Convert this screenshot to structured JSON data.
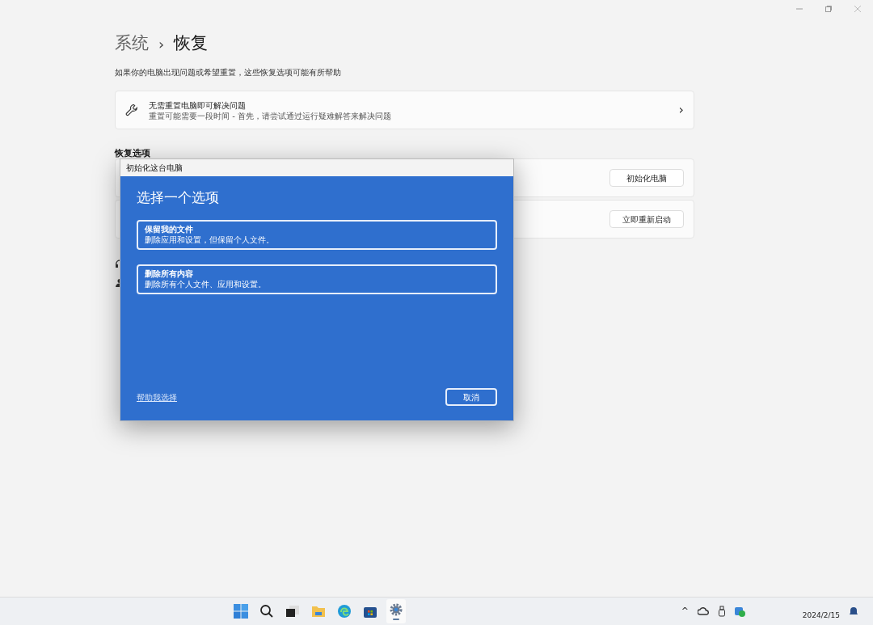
{
  "breadcrumb": {
    "parent": "系统",
    "separator": "›",
    "current": "恢复"
  },
  "subtitle": "如果你的电脑出现问题或希望重置，这些恢复选项可能有所帮助",
  "fix_card": {
    "title": "无需重置电脑即可解决问题",
    "description": "重置可能需要一段时间 - 首先，请尝试通过运行疑难解答来解决问题",
    "chevron": "›"
  },
  "section_title": "恢复选项",
  "option_cards": [
    {
      "button": "初始化电脑"
    },
    {
      "button": "立即重新启动"
    }
  ],
  "dialog": {
    "title": "初始化这台电脑",
    "heading": "选择一个选项",
    "options": [
      {
        "title": "保留我的文件",
        "description": "删除应用和设置，但保留个人文件。"
      },
      {
        "title": "删除所有内容",
        "description": "删除所有个人文件、应用和设置。"
      }
    ],
    "help_link": "帮助我选择",
    "cancel": "取消"
  },
  "taskbar": {
    "apps": [
      {
        "kind": "start",
        "active": false
      },
      {
        "kind": "search",
        "active": false
      },
      {
        "kind": "taskview",
        "active": false
      },
      {
        "kind": "folder",
        "active": false
      },
      {
        "kind": "browser",
        "active": false
      },
      {
        "kind": "store",
        "active": false
      },
      {
        "kind": "settings",
        "active": true
      }
    ],
    "tray_chevron": "^",
    "date": "2024/2/15"
  }
}
